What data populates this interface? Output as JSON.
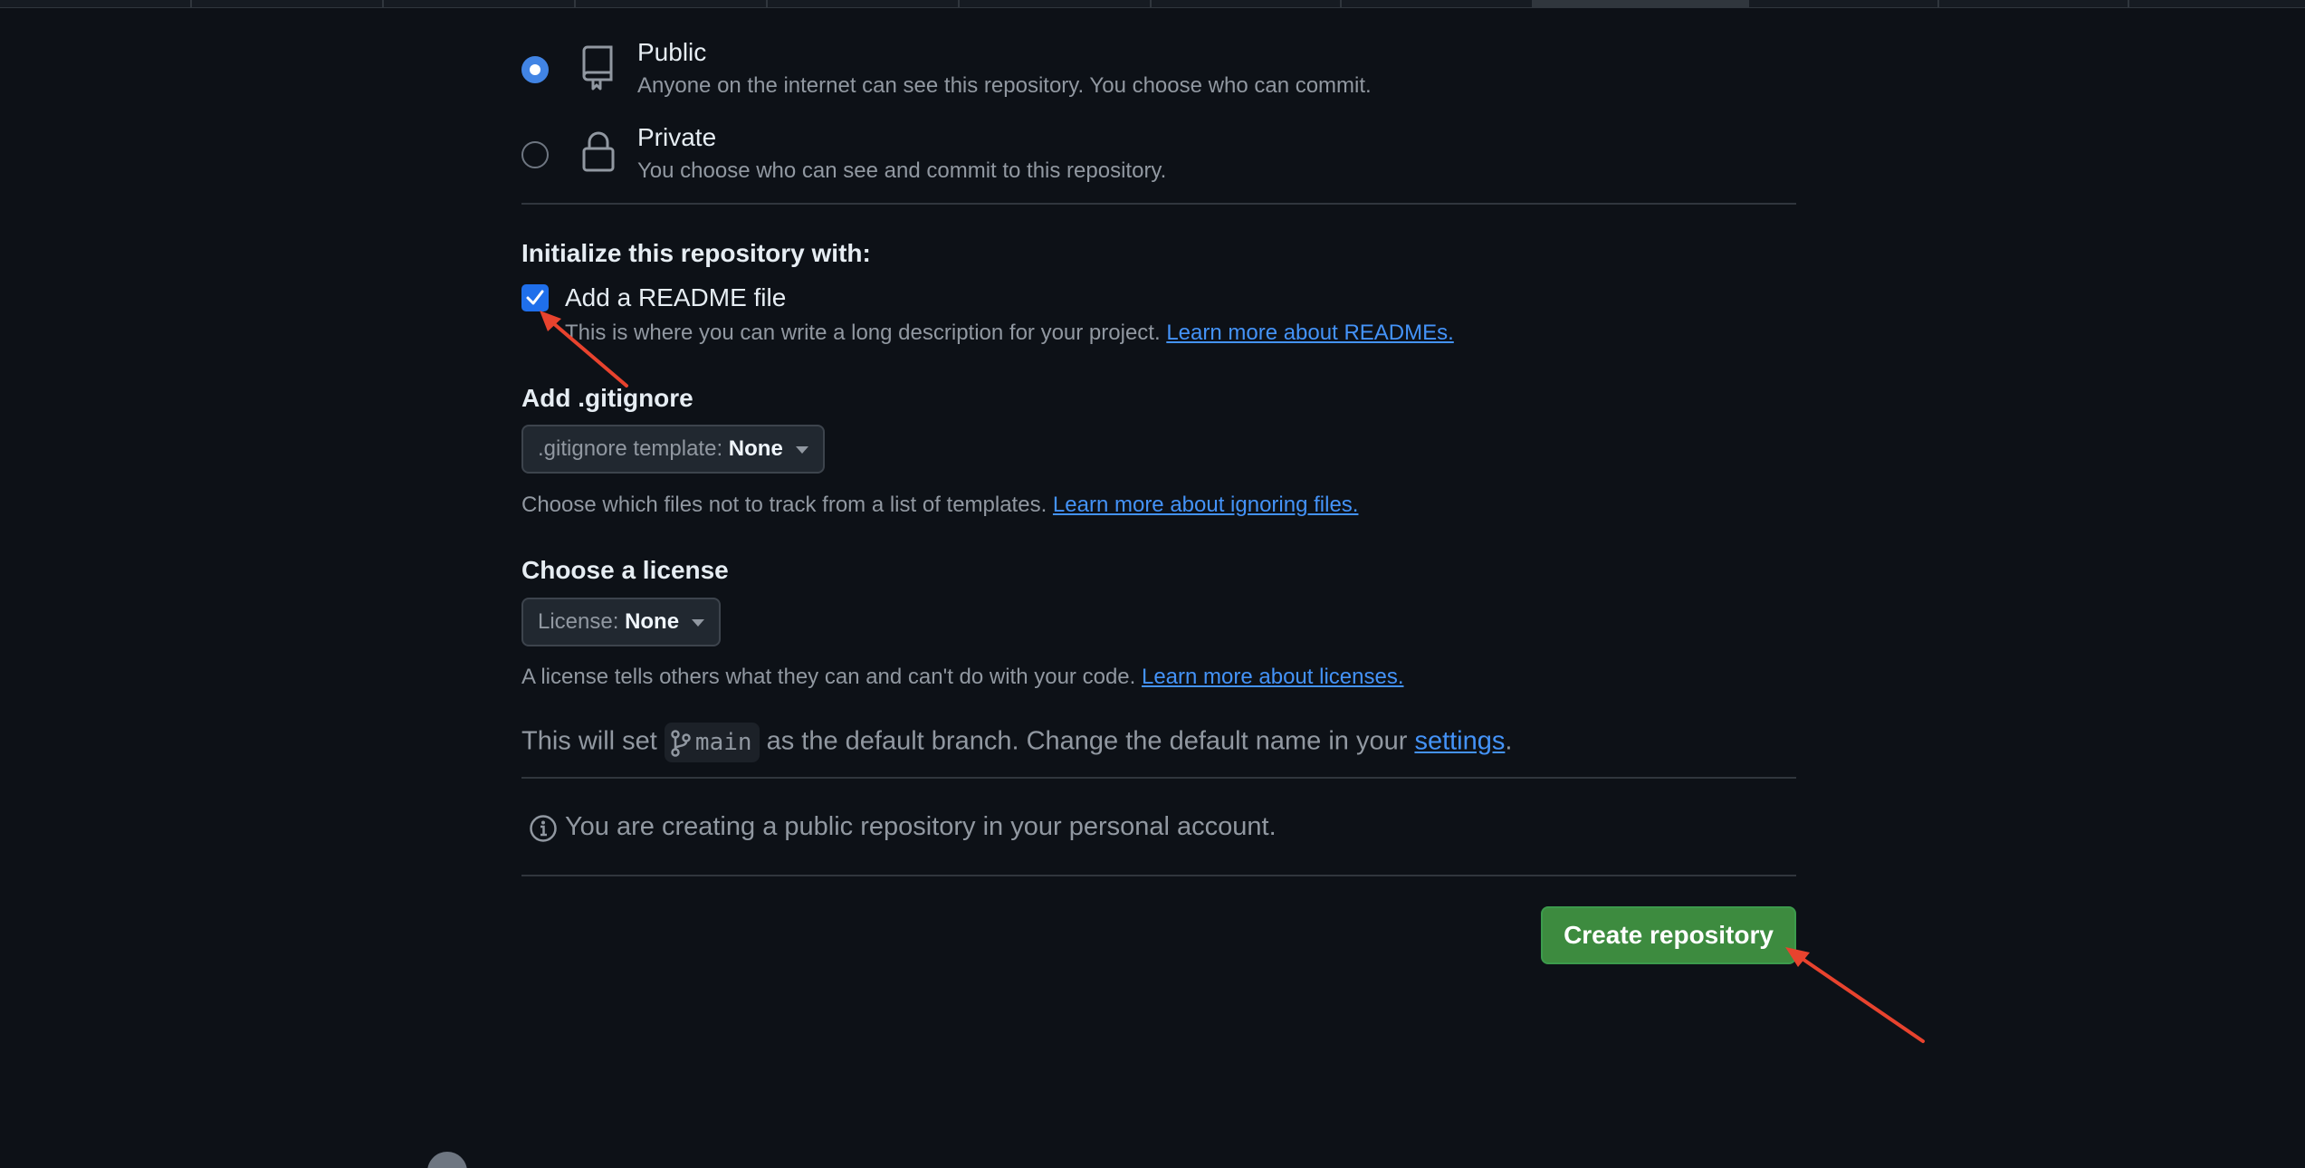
{
  "visibility": {
    "public": {
      "title": "Public",
      "description": "Anyone on the internet can see this repository. You choose who can commit.",
      "selected": true
    },
    "private": {
      "title": "Private",
      "description": "You choose who can see and commit to this repository.",
      "selected": false
    }
  },
  "initialize": {
    "heading": "Initialize this repository with:",
    "readme": {
      "label": "Add a README file",
      "checked": true,
      "help": "This is where you can write a long description for your project.",
      "link": "Learn more about READMEs."
    }
  },
  "gitignore": {
    "heading": "Add .gitignore",
    "select_prefix": ".gitignore template:",
    "select_value": "None",
    "help": "Choose which files not to track from a list of templates.",
    "link": "Learn more about ignoring files."
  },
  "license": {
    "heading": "Choose a license",
    "select_prefix": "License:",
    "select_value": "None",
    "help": "A license tells others what they can and can't do with your code.",
    "link": "Learn more about licenses."
  },
  "branch": {
    "prefix": "This will set",
    "name": "main",
    "suffix": "as the default branch. Change the default name in your",
    "link": "settings",
    "end": "."
  },
  "notice": {
    "text": "You are creating a public repository in your personal account.",
    "icon": "info-icon"
  },
  "actions": {
    "create_label": "Create repository"
  },
  "colors": {
    "accent": "#4493f8",
    "create_button": "#3d8b3f",
    "annotation_arrow": "#e8432e"
  }
}
